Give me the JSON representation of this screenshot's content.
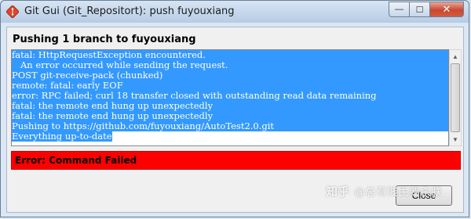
{
  "window": {
    "title": "Git Gui (Git_Repositort): push fuyouxiang",
    "icon": "git-diamond-icon",
    "controls": {
      "minimize": "—",
      "maximize": "☐",
      "close": "✕"
    }
  },
  "dialog": {
    "heading": "Pushing 1 branch to fuyouxiang",
    "log_lines": [
      "fatal: HttpRequestException encountered.",
      "   An error occurred while sending the request.",
      "POST git-receive-pack (chunked)",
      "remote: fatal: early EOF",
      "error: RPC failed; curl 18 transfer closed with outstanding read data remaining",
      "fatal: the remote end hung up unexpectedly",
      "fatal: the remote end hung up unexpectedly",
      "Pushing to https://github.com/fuyouxiang/AutoTest2.0.git",
      "Everything up-to-date"
    ],
    "error_status": "Error: Command Failed",
    "close_label": "Close"
  },
  "colors": {
    "selection": "#3399ff",
    "error": "#ff0000"
  },
  "watermark": {
    "logo": "知乎",
    "text": "@总有贱民要杀朕"
  }
}
